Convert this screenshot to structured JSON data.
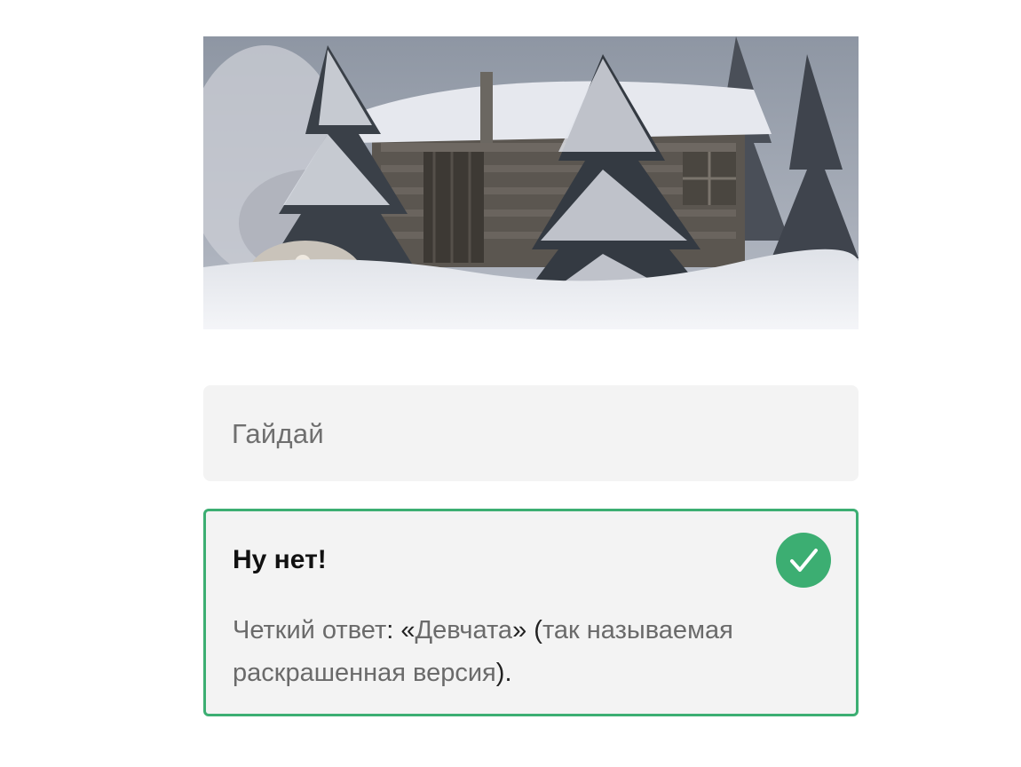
{
  "question": {
    "image_description_icon": "photo-icon"
  },
  "option": {
    "label": "Гайдай"
  },
  "result": {
    "title": "Ну нет!",
    "status_icon": "check-circle-icon",
    "text_prefix": "Четкий ответ",
    "colon": ":",
    "open_quote": "«",
    "answer": "Девчата",
    "close_quote": "»",
    "open_paren": "(",
    "note": "так называемая раскрашенная версия",
    "close_paren": ")",
    "period": "."
  },
  "colors": {
    "accent_green": "#3cae72",
    "card_bg": "#f3f3f3"
  }
}
